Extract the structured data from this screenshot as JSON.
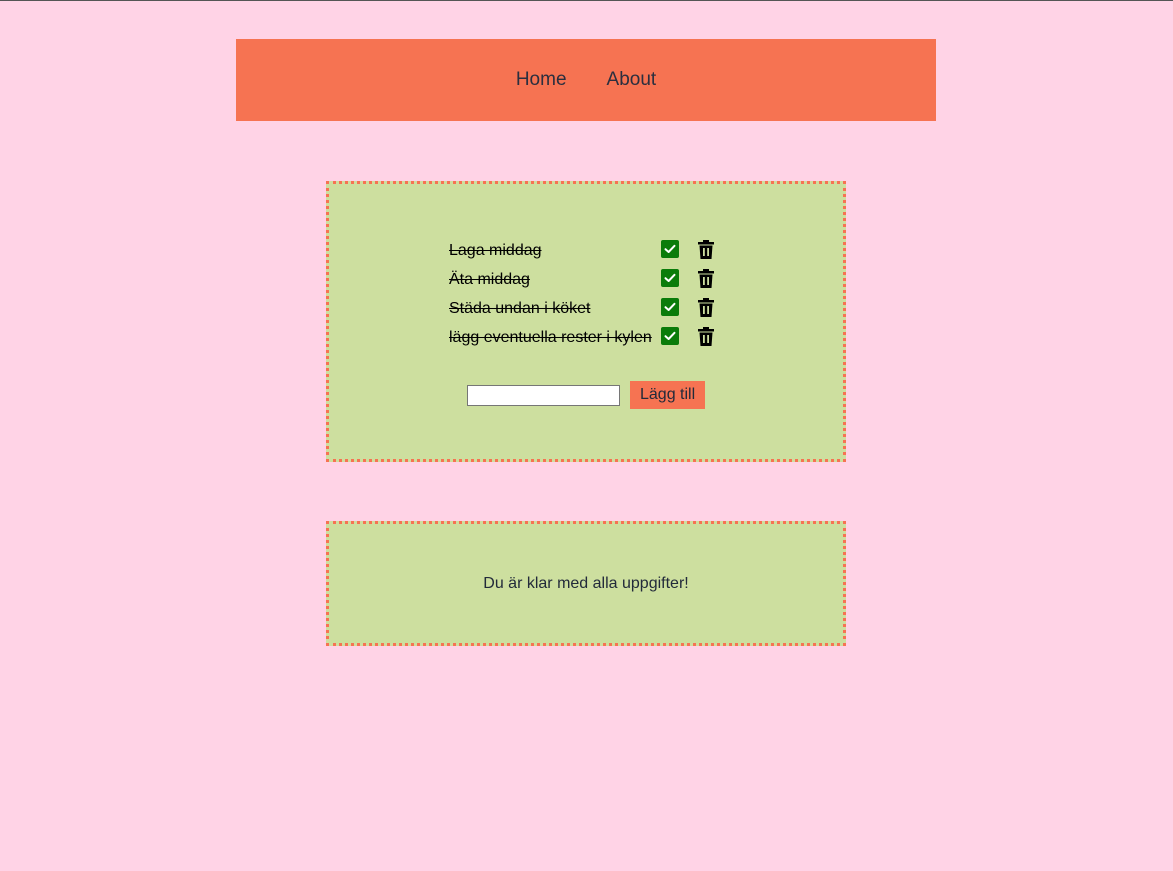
{
  "nav": {
    "items": [
      {
        "label": "Home"
      },
      {
        "label": "About"
      }
    ]
  },
  "todo": {
    "items": [
      {
        "text": "Laga middag",
        "done": true,
        "check_icon": "checkbox-checked-icon",
        "delete_icon": "trash-icon"
      },
      {
        "text": "Äta middag",
        "done": true,
        "check_icon": "checkbox-checked-icon",
        "delete_icon": "trash-icon"
      },
      {
        "text": "Städa undan i köket",
        "done": true,
        "check_icon": "checkbox-checked-icon",
        "delete_icon": "trash-icon"
      },
      {
        "text": "lägg eventuella rester i kylen",
        "done": true,
        "check_icon": "checkbox-checked-icon",
        "delete_icon": "trash-icon"
      }
    ],
    "input": {
      "value": "",
      "placeholder": ""
    },
    "add_label": "Lägg till"
  },
  "done_panel": {
    "message": "Du är klar med alla uppgifter!"
  },
  "colors": {
    "background": "#ffd3e6",
    "accent": "#f67352",
    "card": "#cddf9f",
    "check": "#0a7c0a"
  }
}
